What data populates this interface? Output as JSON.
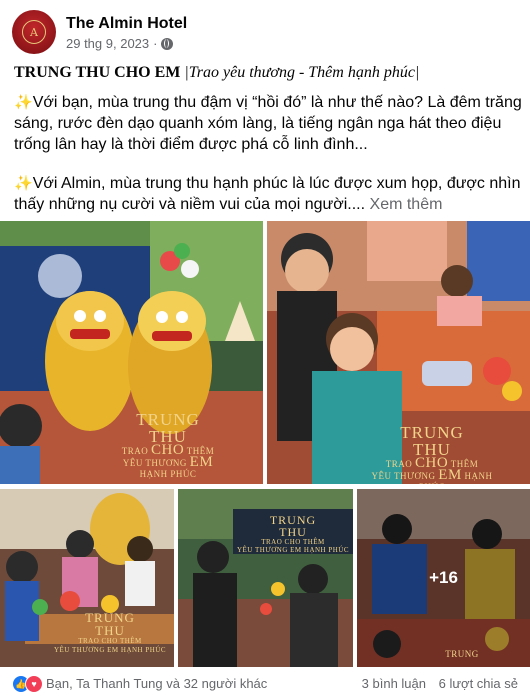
{
  "post": {
    "page_name": "The Almin Hotel",
    "timestamp": "29 thg 9, 2023",
    "separator": "·",
    "title_bold": "TRUNG THU CHO EM",
    "title_italic": "|Trao yêu thương - Thêm hạnh phúc|",
    "para1": "Với bạn, mùa trung thu đậm vị “hồi đó” là như thế nào? Là đêm trăng sáng, rước đèn dạo quanh xóm làng, là tiếng ngân nga hát theo điệu trống lân hay là thời điểm được phá cỗ linh đình...",
    "para2": "Với Almin, mùa trung thu hạnh phúc là lúc được xum họp, được nhìn thấy những nụ cười và niềm vui của mọi người....",
    "see_more": "Xem thêm",
    "sparkle": "✨"
  },
  "caption": {
    "line1": "TRUNG",
    "line2": "THU",
    "line3": "CHO",
    "trao": "TRAO",
    "them": "THÊM",
    "yeu_thuong": "YÊU THƯƠNG",
    "em": "EM",
    "hanh_phuc": "HẠNH PHÚC",
    "bottom_fragment": "TRUNG"
  },
  "photos": {
    "more_count": "+16"
  },
  "footer": {
    "reactors": "Bạn, Ta Thanh Tung và 32 người khác",
    "comments": "3 bình luận",
    "shares": "6 lượt chia sẻ"
  },
  "colors": {
    "caption_gold": "#f1d48a",
    "like_blue": "#1877f2",
    "love_red": "#f33e58",
    "meta_gray": "#65676b"
  }
}
